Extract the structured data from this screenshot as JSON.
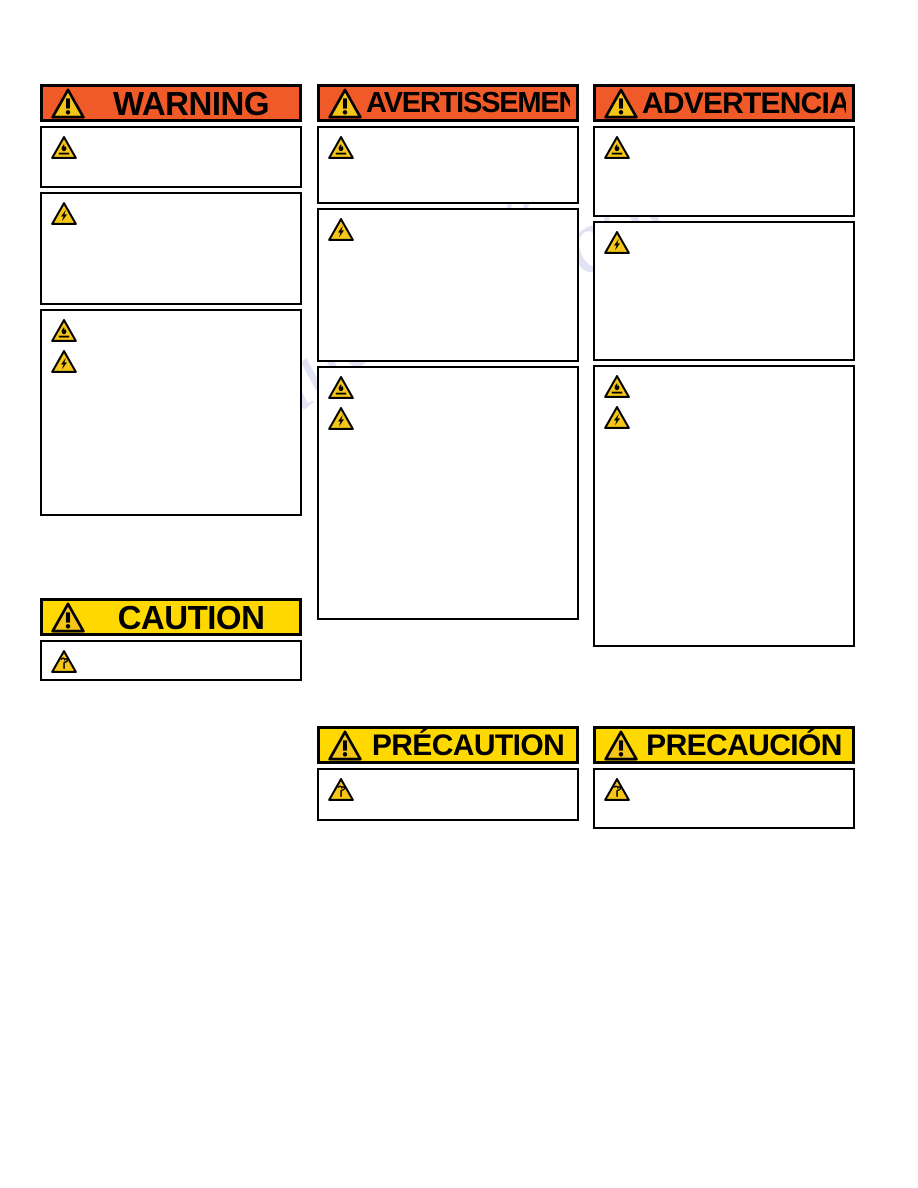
{
  "document": {
    "kind": "safety-label-sheet",
    "languages": [
      "English",
      "French",
      "Spanish"
    ]
  },
  "colors": {
    "warning_orange": "#f05a28",
    "caution_yellow": "#ffd800",
    "hazard_triangle_yellow": "#f5c518",
    "border_black": "#000000",
    "page_white": "#ffffff",
    "watermark_lavender": "#c9cbec"
  },
  "watermark": {
    "line1": "manualshive",
    "line2": ".com"
  },
  "banners": {
    "warning_en": "WARNING",
    "warning_fr": "AVERTISSEMENT",
    "warning_es": "ADVERTENCIA",
    "caution_en": "CAUTION",
    "caution_fr": "PRÉCAUTION",
    "caution_es": "PRECAUCIÓN"
  },
  "icons": {
    "signal_triangle": "warning-exclamation-triangle-icon",
    "fire": "fire-hazard-triangle-icon",
    "shock": "electric-shock-hazard-triangle-icon",
    "burn": "hot-surface-burn-hazard-triangle-icon"
  },
  "columns": {
    "english": {
      "id": "column-english",
      "signal_word": "WARNING",
      "signal_style": "orange",
      "boxes": [
        {
          "id": "en-warning-box-1",
          "icons": [
            "fire"
          ],
          "text": ""
        },
        {
          "id": "en-warning-box-2",
          "icons": [
            "shock"
          ],
          "text": ""
        },
        {
          "id": "en-warning-box-3",
          "icons": [
            "fire",
            "shock"
          ],
          "text": ""
        }
      ],
      "caution": {
        "signal_word": "CAUTION",
        "signal_style": "yellow",
        "boxes": [
          {
            "id": "en-caution-box-1",
            "icons": [
              "burn"
            ],
            "text": ""
          }
        ]
      }
    },
    "french": {
      "id": "column-french",
      "signal_word": "AVERTISSEMENT",
      "signal_style": "orange",
      "boxes": [
        {
          "id": "fr-warning-box-1",
          "icons": [
            "fire"
          ],
          "text": ""
        },
        {
          "id": "fr-warning-box-2",
          "icons": [
            "shock"
          ],
          "text": ""
        },
        {
          "id": "fr-warning-box-3",
          "icons": [
            "fire",
            "shock"
          ],
          "text": ""
        }
      ],
      "caution": {
        "signal_word": "PRÉCAUTION",
        "signal_style": "yellow",
        "boxes": [
          {
            "id": "fr-caution-box-1",
            "icons": [
              "burn"
            ],
            "text": ""
          }
        ]
      }
    },
    "spanish": {
      "id": "column-spanish",
      "signal_word": "ADVERTENCIA",
      "signal_style": "orange",
      "boxes": [
        {
          "id": "es-warning-box-1",
          "icons": [
            "fire"
          ],
          "text": ""
        },
        {
          "id": "es-warning-box-2",
          "icons": [
            "shock"
          ],
          "text": ""
        },
        {
          "id": "es-warning-box-3",
          "icons": [
            "fire",
            "shock"
          ],
          "text": ""
        }
      ],
      "caution": {
        "signal_word": "PRECAUCIÓN",
        "signal_style": "yellow",
        "boxes": [
          {
            "id": "es-caution-box-1",
            "icons": [
              "burn"
            ],
            "text": ""
          }
        ]
      }
    }
  }
}
